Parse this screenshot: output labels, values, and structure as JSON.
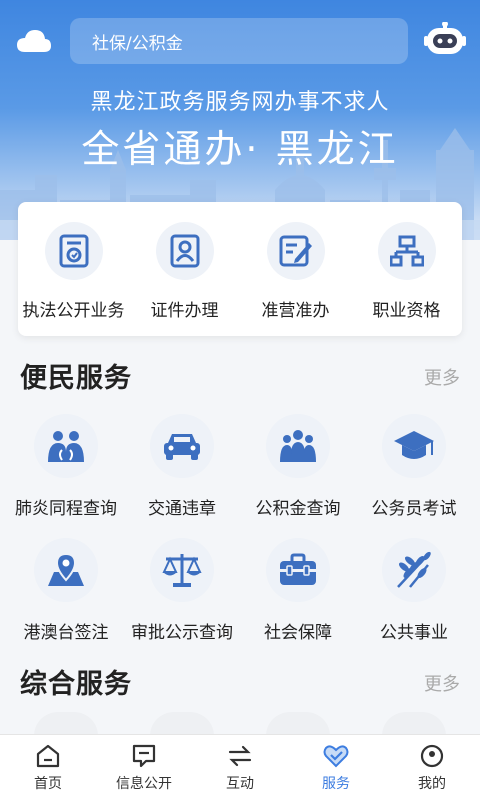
{
  "header": {
    "search_placeholder": "社保/公积金",
    "subtitle": "黑龙江政务服务网办事不求人",
    "title": "全省通办· 黑龙江"
  },
  "quick": [
    {
      "label": "执法公开业务",
      "icon": "law-doc-icon"
    },
    {
      "label": "证件办理",
      "icon": "id-card-icon"
    },
    {
      "label": "准营准办",
      "icon": "edit-doc-icon"
    },
    {
      "label": "职业资格",
      "icon": "org-chart-icon"
    }
  ],
  "convenience": {
    "title": "便民服务",
    "more": "更多",
    "items": [
      {
        "label": "肺炎同程查询",
        "icon": "lungs-people-icon"
      },
      {
        "label": "交通违章",
        "icon": "car-icon"
      },
      {
        "label": "公积金查询",
        "icon": "people-group-icon"
      },
      {
        "label": "公务员考试",
        "icon": "graduation-cap-icon"
      },
      {
        "label": "港澳台签注",
        "icon": "map-pin-icon"
      },
      {
        "label": "审批公示查询",
        "icon": "scales-icon"
      },
      {
        "label": "社会保障",
        "icon": "toolbox-icon"
      },
      {
        "label": "公共事业",
        "icon": "wheat-icon"
      }
    ]
  },
  "comprehensive": {
    "title": "综合服务",
    "more": "更多"
  },
  "nav": [
    {
      "label": "首页",
      "icon": "home-icon"
    },
    {
      "label": "信息公开",
      "icon": "message-icon"
    },
    {
      "label": "互动",
      "icon": "exchange-icon"
    },
    {
      "label": "服务",
      "icon": "heart-icon",
      "active": true
    },
    {
      "label": "我的",
      "icon": "user-icon"
    }
  ],
  "colors": {
    "primary": "#3d6fc0",
    "accent": "#3d7de0",
    "hero": "#4a8de2"
  }
}
